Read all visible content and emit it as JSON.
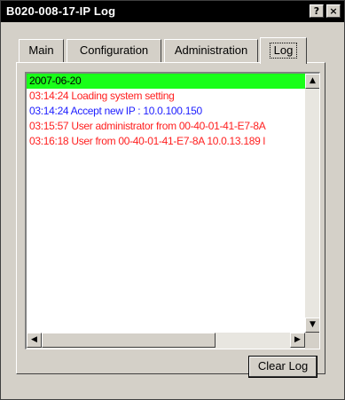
{
  "window": {
    "title": "B020-008-17-IP Log",
    "help_glyph": "?",
    "close_glyph": "×"
  },
  "tabs": [
    {
      "label": "Main"
    },
    {
      "label": "Configuration"
    },
    {
      "label": "Administration"
    },
    {
      "label": "Log",
      "active": true
    }
  ],
  "log": {
    "lines": [
      {
        "text": "2007-06-20",
        "color": "#000000",
        "selected": true
      },
      {
        "text": "03:14:24 Loading system setting",
        "color": "#ff2020"
      },
      {
        "text": "03:14:24 Accept new IP : 10.0.100.150",
        "color": "#2020ff"
      },
      {
        "text": "03:15:57 User administrator from 00-40-01-41-E7-8A",
        "color": "#ff2020"
      },
      {
        "text": "03:16:18 User from 00-40-01-41-E7-8A 10.0.13.189 l",
        "color": "#ff2020"
      }
    ],
    "selection_color": "#19ff19"
  },
  "scroll_arrows": {
    "up": "▲",
    "down": "▼",
    "left": "◀",
    "right": "▶"
  },
  "buttons": {
    "clear_log": "Clear Log"
  }
}
